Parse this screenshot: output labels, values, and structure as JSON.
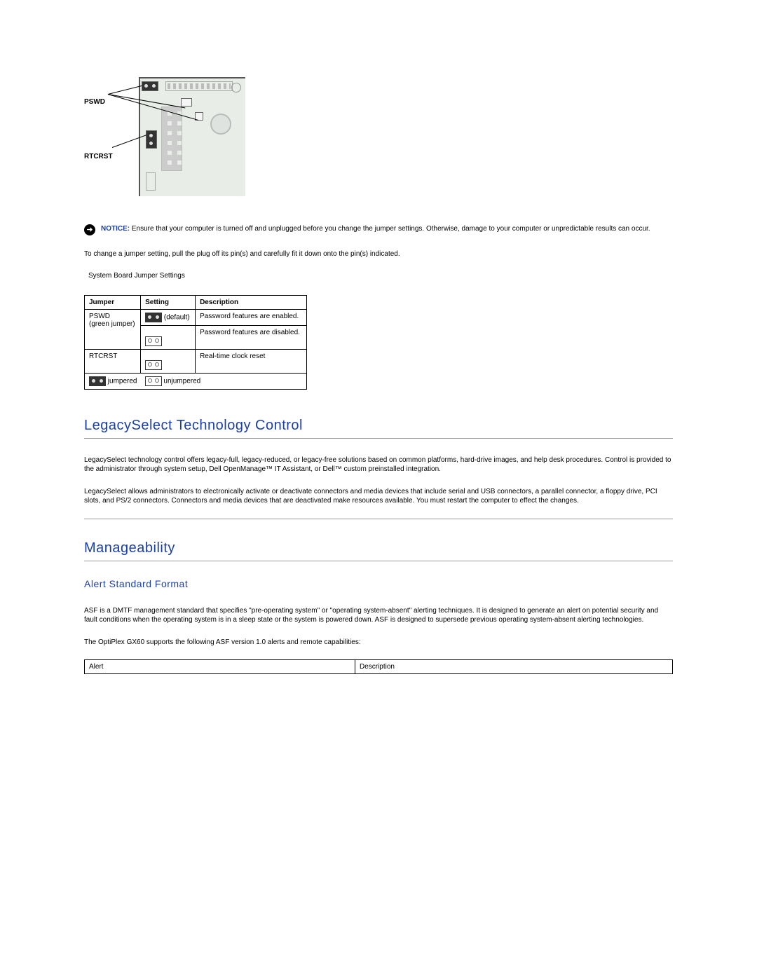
{
  "diagram": {
    "label_pswd": "PSWD",
    "label_rtcrst": "RTCRST"
  },
  "notice": {
    "label": "NOTICE:",
    "text": "Ensure that your computer is turned off and unplugged before you change the jumper settings. Otherwise, damage to your computer or unpredictable results can occur."
  },
  "change_para": "To change a jumper setting, pull the plug off its pin(s) and carefully fit it down onto the pin(s) indicated.",
  "table_caption": "System Board Jumper Settings",
  "jumper_table": {
    "headers": {
      "c1": "Jumper",
      "c2": "Setting",
      "c3": "Description"
    },
    "rows": [
      {
        "jumper_l1": "PSWD",
        "jumper_l2": "(green jumper)",
        "setting_note": "(default)",
        "desc": "Password features are enabled."
      },
      {
        "desc": "Password features are disabled."
      },
      {
        "jumper": "RTCRST",
        "desc": "Real-time clock reset"
      }
    ],
    "legend": {
      "jumpered": "jumpered",
      "unjumpered": "unjumpered"
    }
  },
  "legacy": {
    "heading": "LegacySelect Technology Control",
    "p1": "LegacySelect technology control offers legacy-full, legacy-reduced, or legacy-free solutions based on common platforms, hard-drive images, and help desk procedures. Control is provided to the administrator through system setup, Dell OpenManage™ IT Assistant, or Dell™ custom preinstalled integration.",
    "p2": "LegacySelect allows administrators to electronically activate or deactivate connectors and media devices that include serial and USB connectors, a parallel connector, a floppy drive, PCI slots, and PS/2 connectors. Connectors and media devices that are deactivated make resources available. You must restart the computer to effect the changes."
  },
  "manage": {
    "heading": "Manageability",
    "sub": "Alert Standard Format",
    "p1": "ASF is a DMTF management standard that specifies \"pre-operating system\" or \"operating system-absent\" alerting techniques. It is designed to generate an alert on potential security and fault conditions when the operating system is in a sleep state or the system is powered down. ASF is designed to supersede previous operating system-absent alerting technologies.",
    "p2": "The OptiPlex GX60 supports the following ASF version 1.0 alerts and remote capabilities:"
  },
  "alert_table": {
    "h1": "Alert",
    "h2": "Description"
  }
}
